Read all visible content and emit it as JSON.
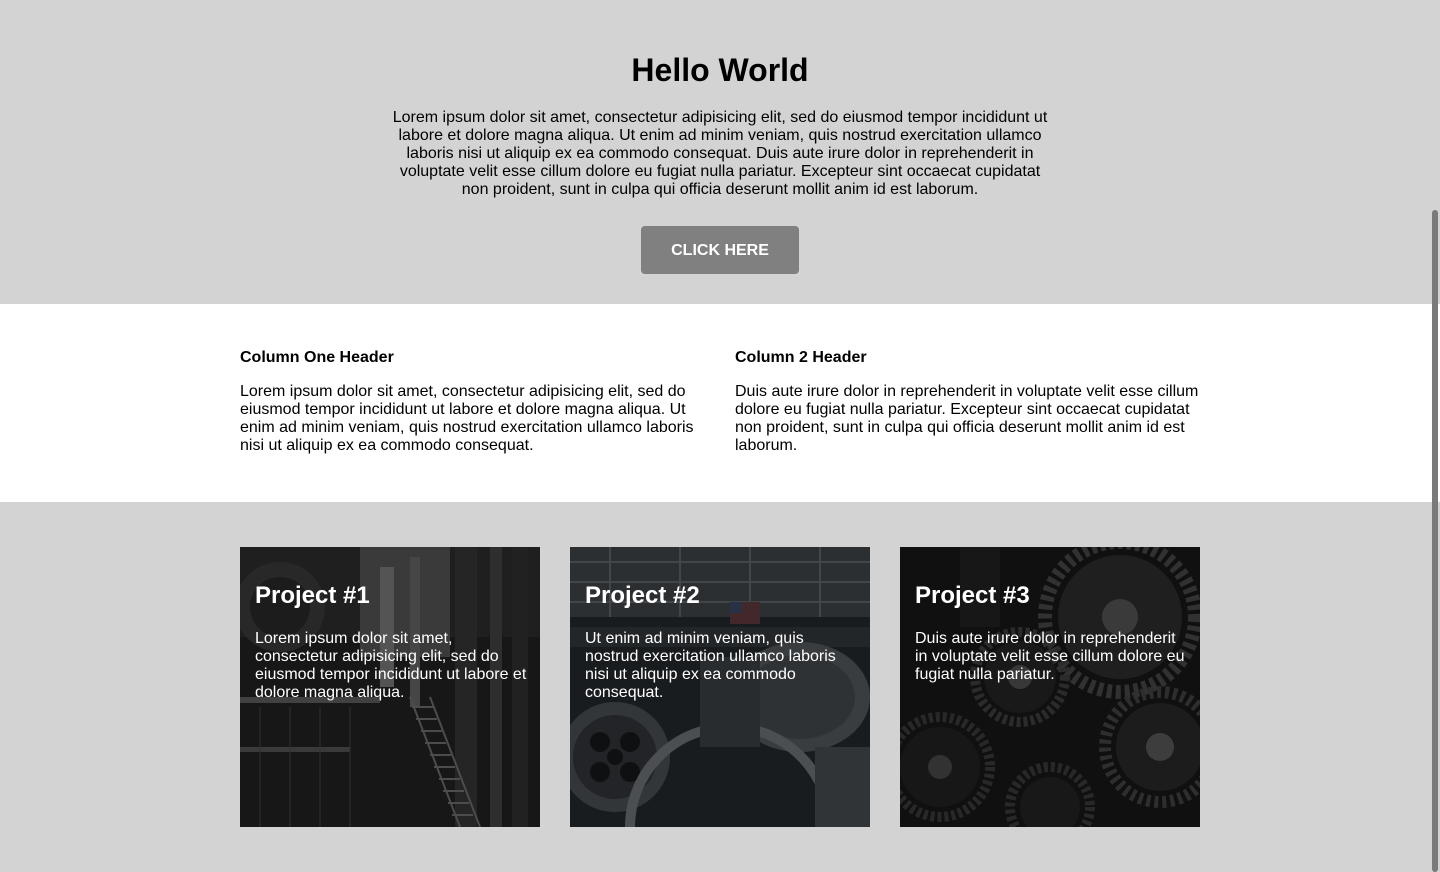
{
  "hero": {
    "title": "Hello World",
    "body": "Lorem ipsum dolor sit amet, consectetur adipisicing elit, sed do eiusmod tempor incididunt ut labore et dolore magna aliqua. Ut enim ad minim veniam, quis nostrud exercitation ullamco laboris nisi ut aliquip ex ea commodo consequat. Duis aute irure dolor in reprehenderit in voluptate velit esse cillum dolore eu fugiat nulla pariatur. Excepteur sint occaecat cupidatat non proident, sunt in culpa qui officia deserunt mollit anim id est laborum.",
    "button_label": "CLICK HERE"
  },
  "columns": [
    {
      "header": "Column One Header",
      "body": "Lorem ipsum dolor sit amet, consectetur adipisicing elit, sed do eiusmod tempor incididunt ut labore et dolore magna aliqua. Ut enim ad minim veniam, quis nostrud exercitation ullamco laboris nisi ut aliquip ex ea commodo consequat."
    },
    {
      "header": "Column 2 Header",
      "body": "Duis aute irure dolor in reprehenderit in voluptate velit esse cillum dolore eu fugiat nulla pariatur. Excepteur sint occaecat cupidatat non proident, sunt in culpa qui officia deserunt mollit anim id est laborum."
    }
  ],
  "projects": [
    {
      "title": "Project #1",
      "body": "Lorem ipsum dolor sit amet, consectetur adipisicing elit, sed do eiusmod tempor incididunt ut labore et dolore magna aliqua."
    },
    {
      "title": "Project #2",
      "body": "Ut enim ad minim veniam, quis nostrud exercitation ullamco laboris nisi ut aliquip ex ea commodo consequat."
    },
    {
      "title": "Project #3",
      "body": "Duis aute irure dolor in reprehenderit in voluptate velit esse cillum dolore eu fugiat nulla pariatur."
    }
  ],
  "colors": {
    "hero_background": "#d3d3d3",
    "columns_background": "#ffffff",
    "projects_background": "#d3d3d3",
    "button_background": "#808080",
    "button_text": "#ffffff"
  }
}
